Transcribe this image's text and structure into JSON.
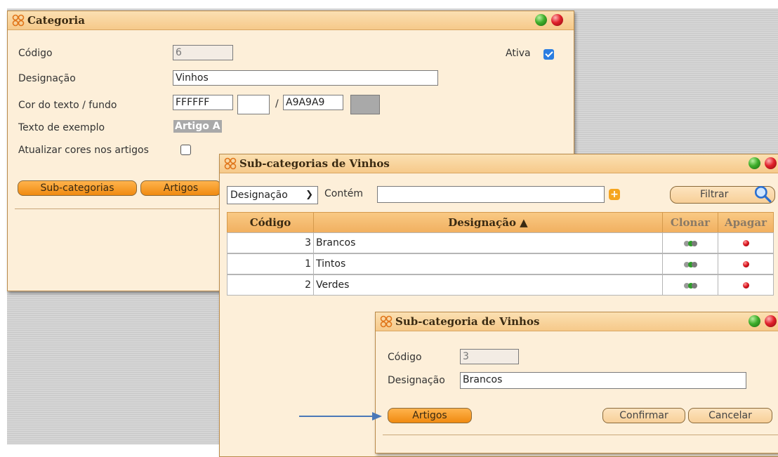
{
  "colors": {
    "accent": "#f08a10",
    "window_bg": "#fdefd9",
    "example_bg": "#A9A9A9",
    "example_fg": "#FFFFFF",
    "arrow": "#4a78b8"
  },
  "categoria": {
    "title": "Categoria",
    "codigo_label": "Código",
    "codigo_value": "6",
    "ativa_label": "Ativa",
    "ativa_checked": true,
    "designacao_label": "Designação",
    "designacao_value": "Vinhos",
    "cor_label": "Cor do texto / fundo",
    "cor_texto": "FFFFFF",
    "cor_sep": "/",
    "cor_fundo": "A9A9A9",
    "exemplo_label": "Texto de exemplo",
    "exemplo_text": "Artigo A",
    "atualizar_label": "Atualizar cores nos artigos",
    "atualizar_checked": false,
    "btn_subcategorias": "Sub-categorias",
    "btn_artigos": "Artigos"
  },
  "subcategorias": {
    "title": "Sub-categorias de Vinhos",
    "filter_field": "Designação",
    "filter_op": "Contém",
    "filter_value": "",
    "filter_button": "Filtrar",
    "columns": {
      "codigo": "Código",
      "designacao": "Designação ▲",
      "clonar": "Clonar",
      "apagar": "Apagar"
    },
    "rows": [
      {
        "codigo": "3",
        "designacao": "Brancos"
      },
      {
        "codigo": "1",
        "designacao": "Tintos"
      },
      {
        "codigo": "2",
        "designacao": "Verdes"
      }
    ]
  },
  "subcategoria": {
    "title": "Sub-categoria de Vinhos",
    "codigo_label": "Código",
    "codigo_value": "3",
    "designacao_label": "Designação",
    "designacao_value": "Brancos",
    "btn_artigos": "Artigos",
    "btn_confirmar": "Confirmar",
    "btn_cancelar": "Cancelar"
  }
}
